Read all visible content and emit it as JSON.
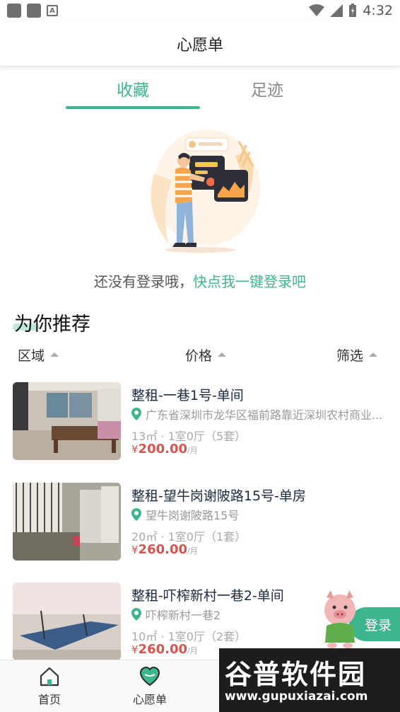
{
  "status_bar": {
    "time": "4:32"
  },
  "header": {
    "title": "心愿单"
  },
  "tabs": [
    {
      "label": "收藏",
      "active": true
    },
    {
      "label": "足迹",
      "active": false
    }
  ],
  "empty_state": {
    "prefix": "还没有登录哦，",
    "link": "快点我一键登录吧"
  },
  "recommend": {
    "title": "为你推荐",
    "filters": [
      "区域",
      "价格",
      "筛选"
    ]
  },
  "listings": [
    {
      "title": "整租-一巷1号-单间",
      "address": "广东省深圳市龙华区福前路靠近深圳农村商业...",
      "meta": "13㎡ · 1室0厅（5套）",
      "currency": "¥",
      "price": "200.00",
      "unit": "/月"
    },
    {
      "title": "整租-望牛岗谢陂路15号-单房",
      "address": "望牛岗谢陂路15号",
      "meta": "20㎡ · 1室0厅（1套）",
      "currency": "¥",
      "price": "260.00",
      "unit": "/月"
    },
    {
      "title": "整租-吓榨新村一巷2-单间",
      "address": "吓榨新村一巷2",
      "meta": "10㎡ · 1室0厅（2套）",
      "currency": "¥",
      "price": "260.00",
      "unit": "/月"
    }
  ],
  "float_login": {
    "label": "登录"
  },
  "bottom_nav": [
    {
      "label": "首页",
      "icon": "home-icon"
    },
    {
      "label": "心愿单",
      "icon": "heart-icon"
    }
  ],
  "watermark": {
    "text": "谷普软件园",
    "url": "www.gupuxiazai.com"
  },
  "colors": {
    "accent": "#3db58e",
    "price": "#d9534f"
  }
}
